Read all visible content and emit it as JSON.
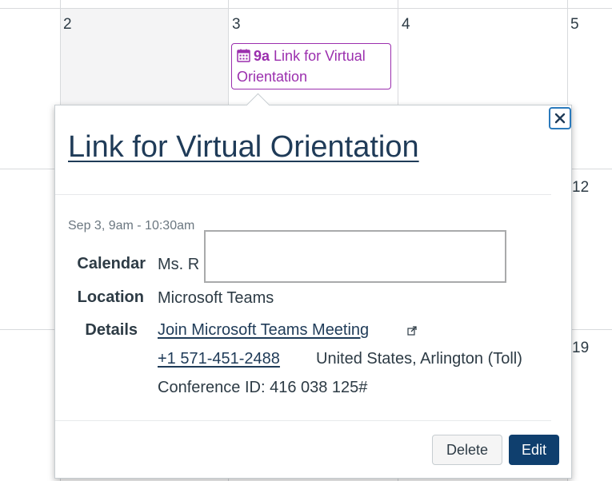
{
  "calendar": {
    "day_numbers": {
      "d2": "2",
      "d3": "3",
      "d4": "4",
      "d5": "5",
      "d12": "12",
      "d19": "19"
    },
    "event_chip": {
      "time": "9a",
      "line1": "Link for Virtual",
      "line2": "Orientation",
      "icon": "calendar-icon",
      "color": "#9b2fae"
    }
  },
  "popover": {
    "title": "Link for Virtual Orientation",
    "date_range": "Sep 3, 9am - 10:30am",
    "close_icon": "close-icon",
    "calendar_label": "Calendar",
    "calendar_value": "Ms. R",
    "location_label": "Location",
    "location_value": "Microsoft Teams",
    "details_label": "Details",
    "details_link": "Join Microsoft Teams Meeting",
    "external_link_icon": "external-link-icon",
    "phone_link": "+1 571-451-2488",
    "phone_location": "United States, Arlington (Toll)",
    "conference_id": "Conference ID: 416 038 125#",
    "delete_label": "Delete",
    "edit_label": "Edit",
    "accent_color": "#0f3f6e"
  }
}
